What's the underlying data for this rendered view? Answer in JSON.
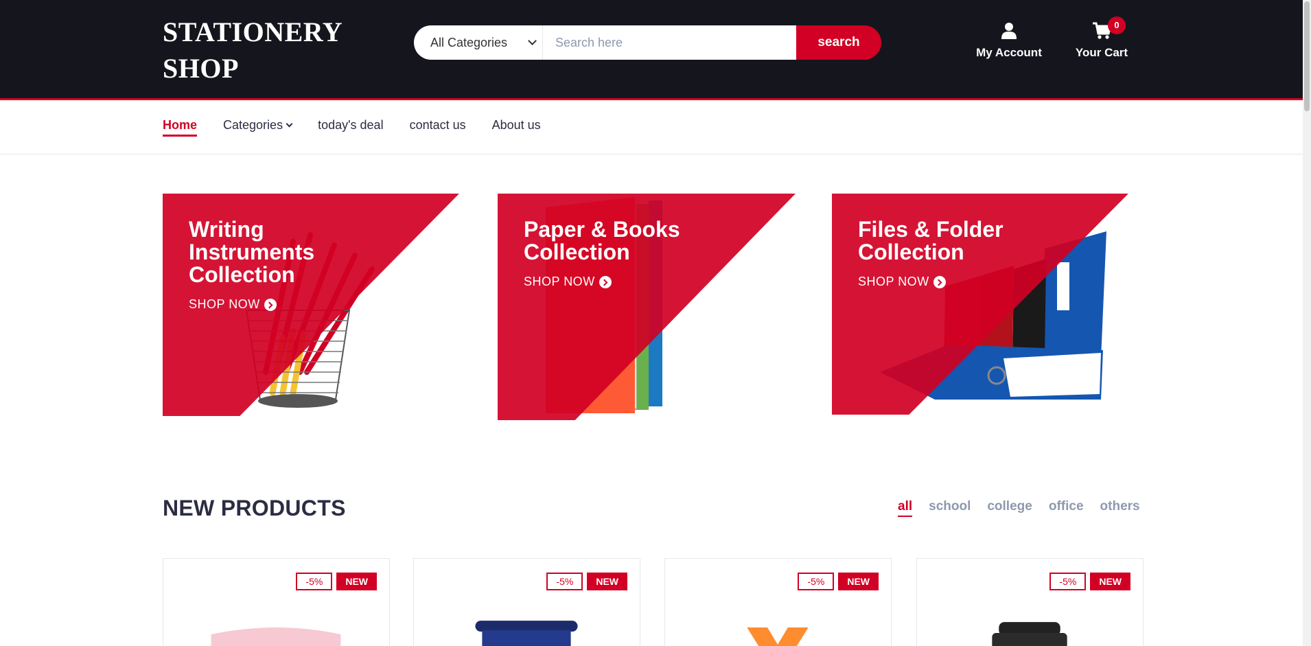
{
  "header": {
    "logo_line1": "STATIONERY",
    "logo_line2": "SHOP",
    "category_select": "All Categories",
    "search_placeholder": "Search here",
    "search_button": "search",
    "account_label": "My Account",
    "cart_label": "Your Cart",
    "cart_count": "0"
  },
  "nav": {
    "items": [
      {
        "label": "Home",
        "active": true
      },
      {
        "label": "Categories"
      },
      {
        "label": "today's deal"
      },
      {
        "label": "contact us"
      },
      {
        "label": "About us"
      }
    ]
  },
  "collections": [
    {
      "title": "Writing Instruments Collection",
      "cta": "SHOP NOW"
    },
    {
      "title": "Paper & Books Collection",
      "cta": "SHOP NOW"
    },
    {
      "title": "Files & Folder Collection",
      "cta": "SHOP NOW"
    }
  ],
  "new_products": {
    "title": "NEW PRODUCTS",
    "tabs": [
      "all",
      "school",
      "college",
      "office",
      "others"
    ],
    "active_tab": "all",
    "products": [
      {
        "sale": "-5%",
        "badge": "NEW"
      },
      {
        "sale": "-5%",
        "badge": "NEW"
      },
      {
        "sale": "-5%",
        "badge": "NEW"
      },
      {
        "sale": "-5%",
        "badge": "NEW"
      }
    ]
  },
  "colors": {
    "primary": "#d10024",
    "header_bg": "#15161d",
    "text_dark": "#2b2d42",
    "text_muted": "#8d99ae"
  }
}
